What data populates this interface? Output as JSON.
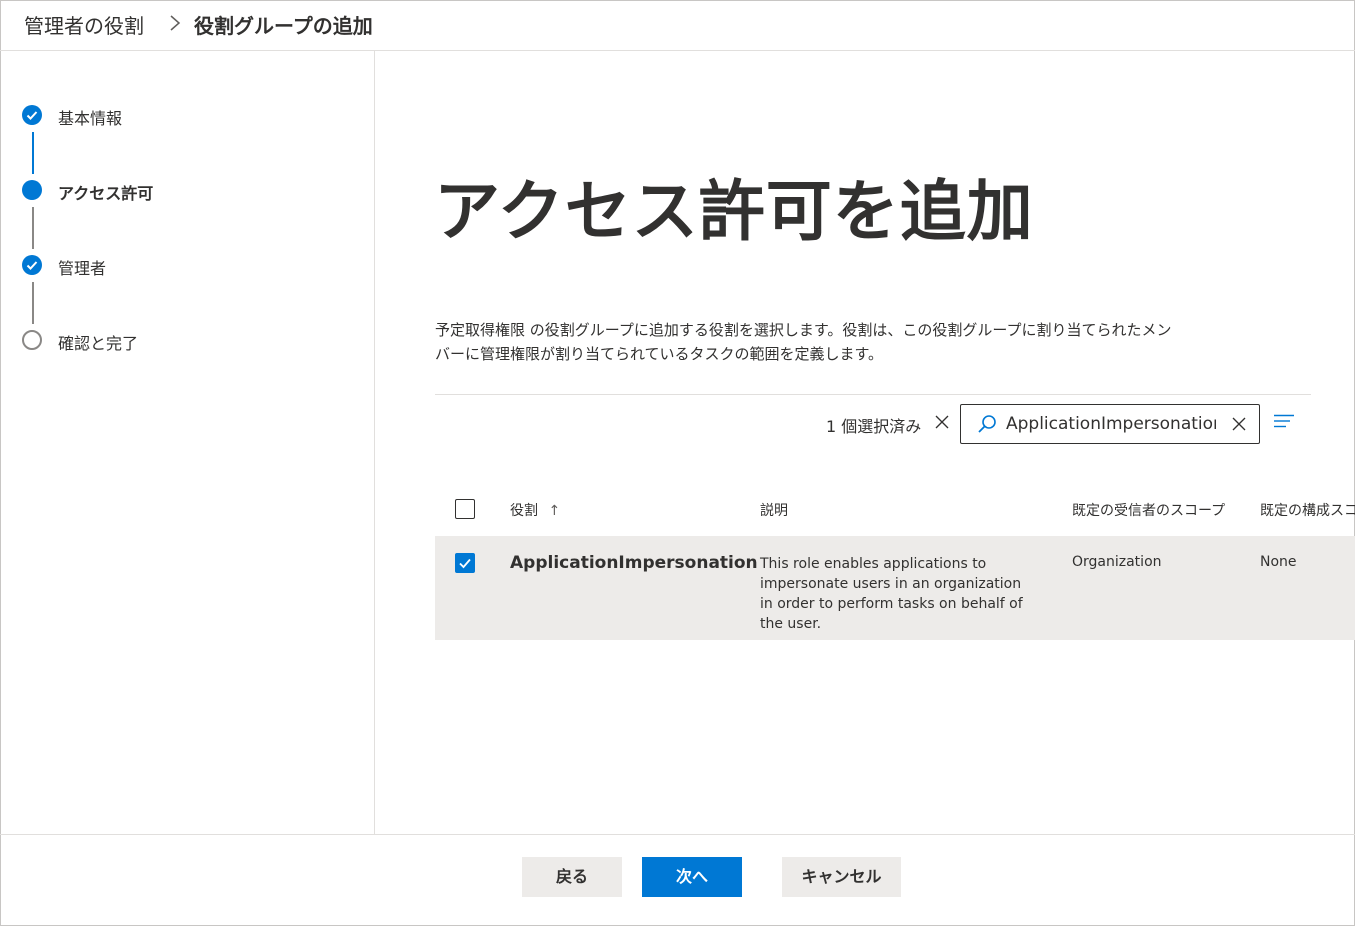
{
  "breadcrumb": {
    "parent": "管理者の役割",
    "current": "役割グループの追加"
  },
  "steps": [
    {
      "label": "基本情報",
      "state": "done"
    },
    {
      "label": "アクセス許可",
      "state": "current"
    },
    {
      "label": "管理者",
      "state": "done"
    },
    {
      "label": "確認と完了",
      "state": "todo"
    }
  ],
  "main": {
    "title": "アクセス許可を追加",
    "description": "予定取得権限 の役割グループに追加する役割を選択します。役割は、この役割グループに割り当てられたメンバーに管理権限が割り当てられているタスクの範囲を定義します。"
  },
  "toolbar": {
    "selected_count": "1 個選択済み",
    "search_value": "ApplicationImpersonation"
  },
  "table": {
    "headers": {
      "role": "役割",
      "sort_arrow": "↑",
      "description": "説明",
      "recipient_scope": "既定の受信者のスコープ",
      "config_scope": "既定の構成スコープ"
    },
    "rows": [
      {
        "role": "ApplicationImpersonation",
        "description": "This role enables applications to impersonate users in an organization in order to perform tasks on behalf of the user.",
        "recipient_scope": "Organization",
        "config_scope": "None",
        "selected": true
      }
    ]
  },
  "footer": {
    "back": "戻る",
    "next": "次へ",
    "cancel": "キャンセル"
  },
  "colors": {
    "accent": "#0078d4",
    "row_selected": "#edebe9",
    "button_secondary": "#edebe9"
  }
}
